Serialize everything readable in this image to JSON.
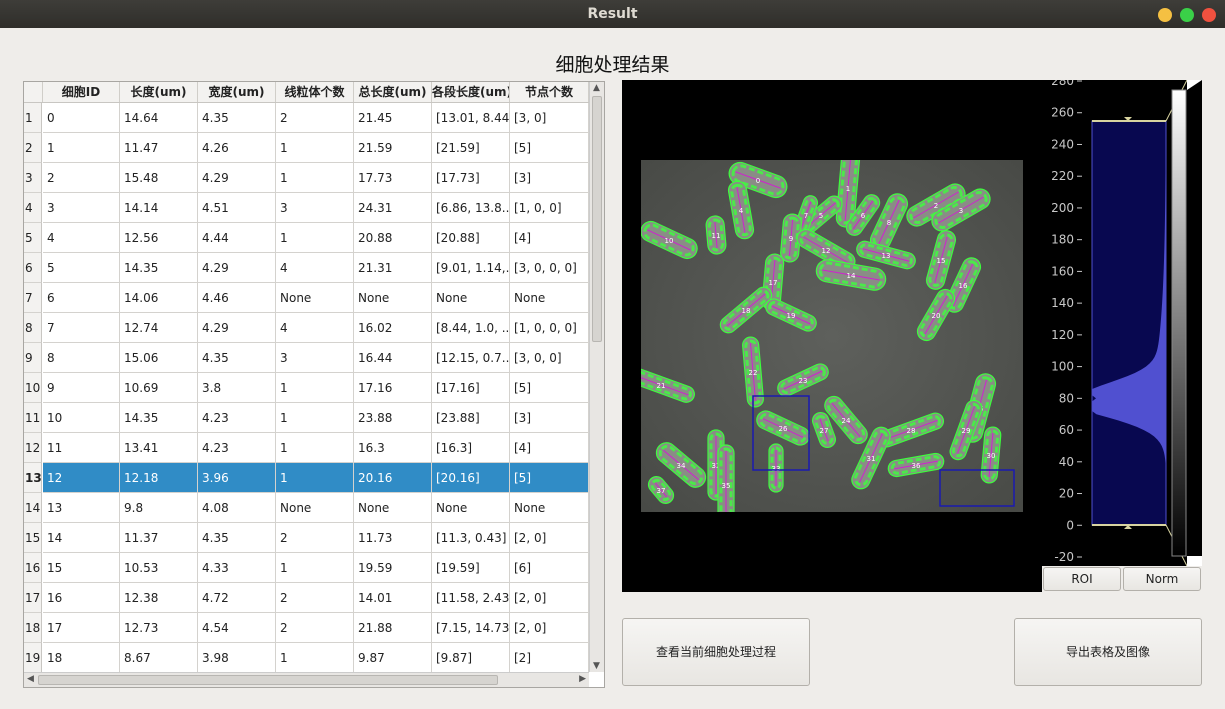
{
  "window": {
    "title": "Result"
  },
  "heading": "细胞处理结果",
  "table": {
    "headers": [
      "细胞ID",
      "长度(um)",
      "宽度(um)",
      "线粒体个数",
      "总长度(um)",
      "各段长度(um)",
      "节点个数"
    ],
    "selected_row": 13,
    "rows": [
      {
        "n": "1",
        "id": "0",
        "len": "14.64",
        "wid": "4.35",
        "mito": "2",
        "total": "21.45",
        "seg": "[13.01, 8.44]",
        "nodes": "[3, 0]"
      },
      {
        "n": "2",
        "id": "1",
        "len": "11.47",
        "wid": "4.26",
        "mito": "1",
        "total": "21.59",
        "seg": "[21.59]",
        "nodes": "[5]"
      },
      {
        "n": "3",
        "id": "2",
        "len": "15.48",
        "wid": "4.29",
        "mito": "1",
        "total": "17.73",
        "seg": "[17.73]",
        "nodes": "[3]"
      },
      {
        "n": "4",
        "id": "3",
        "len": "14.14",
        "wid": "4.51",
        "mito": "3",
        "total": "24.31",
        "seg": "[6.86, 13.8...",
        "nodes": "[1, 0, 0]"
      },
      {
        "n": "5",
        "id": "4",
        "len": "12.56",
        "wid": "4.44",
        "mito": "1",
        "total": "20.88",
        "seg": "[20.88]",
        "nodes": "[4]"
      },
      {
        "n": "6",
        "id": "5",
        "len": "14.35",
        "wid": "4.29",
        "mito": "4",
        "total": "21.31",
        "seg": "[9.01, 1.14,...",
        "nodes": "[3, 0, 0, 0]"
      },
      {
        "n": "7",
        "id": "6",
        "len": "14.06",
        "wid": "4.46",
        "mito": "None",
        "total": "None",
        "seg": "None",
        "nodes": "None"
      },
      {
        "n": "8",
        "id": "7",
        "len": "12.74",
        "wid": "4.29",
        "mito": "4",
        "total": "16.02",
        "seg": "[8.44, 1.0, ...",
        "nodes": "[1, 0, 0, 0]"
      },
      {
        "n": "9",
        "id": "8",
        "len": "15.06",
        "wid": "4.35",
        "mito": "3",
        "total": "16.44",
        "seg": "[12.15, 0.7...",
        "nodes": "[3, 0, 0]"
      },
      {
        "n": "10",
        "id": "9",
        "len": "10.69",
        "wid": "3.8",
        "mito": "1",
        "total": "17.16",
        "seg": "[17.16]",
        "nodes": "[5]"
      },
      {
        "n": "11",
        "id": "10",
        "len": "14.35",
        "wid": "4.23",
        "mito": "1",
        "total": "23.88",
        "seg": "[23.88]",
        "nodes": "[3]"
      },
      {
        "n": "12",
        "id": "11",
        "len": "13.41",
        "wid": "4.23",
        "mito": "1",
        "total": "16.3",
        "seg": "[16.3]",
        "nodes": "[4]"
      },
      {
        "n": "13",
        "id": "12",
        "len": "12.18",
        "wid": "3.96",
        "mito": "1",
        "total": "20.16",
        "seg": "[20.16]",
        "nodes": "[5]"
      },
      {
        "n": "14",
        "id": "13",
        "len": "9.8",
        "wid": "4.08",
        "mito": "None",
        "total": "None",
        "seg": "None",
        "nodes": "None"
      },
      {
        "n": "15",
        "id": "14",
        "len": "11.37",
        "wid": "4.35",
        "mito": "2",
        "total": "11.73",
        "seg": "[11.3, 0.43]",
        "nodes": "[2, 0]"
      },
      {
        "n": "16",
        "id": "15",
        "len": "10.53",
        "wid": "4.33",
        "mito": "1",
        "total": "19.59",
        "seg": "[19.59]",
        "nodes": "[6]"
      },
      {
        "n": "17",
        "id": "16",
        "len": "12.38",
        "wid": "4.72",
        "mito": "2",
        "total": "14.01",
        "seg": "[11.58, 2.43]",
        "nodes": "[2, 0]"
      },
      {
        "n": "18",
        "id": "17",
        "len": "12.73",
        "wid": "4.54",
        "mito": "2",
        "total": "21.88",
        "seg": "[7.15, 14.73]",
        "nodes": "[2, 0]"
      },
      {
        "n": "19",
        "id": "18",
        "len": "8.67",
        "wid": "3.98",
        "mito": "1",
        "total": "9.87",
        "seg": "[9.87]",
        "nodes": "[2]"
      }
    ]
  },
  "image": {
    "cell_labels": [
      "0",
      "1",
      "2",
      "3",
      "4",
      "5",
      "6",
      "7",
      "8",
      "9",
      "10",
      "11",
      "12",
      "13",
      "14",
      "15",
      "16",
      "17",
      "18",
      "19",
      "20",
      "21",
      "22",
      "23",
      "24",
      "25",
      "26",
      "27",
      "28",
      "29",
      "30",
      "31",
      "32",
      "33",
      "34",
      "35",
      "36",
      "37"
    ]
  },
  "histogram": {
    "y_ticks": [
      "280",
      "260",
      "240",
      "220",
      "200",
      "180",
      "160",
      "140",
      "120",
      "100",
      "80",
      "60",
      "40",
      "20",
      "0",
      "-20"
    ],
    "roi_label": "ROI",
    "norm_label": "Norm"
  },
  "buttons": {
    "view_process": "查看当前细胞处理过程",
    "export": "导出表格及图像"
  },
  "colors": {
    "selection": "#308cc6",
    "cell_outline": "#3cff3c",
    "histogram_fill": "#5050d0",
    "roi_box": "#1a1ab0"
  }
}
